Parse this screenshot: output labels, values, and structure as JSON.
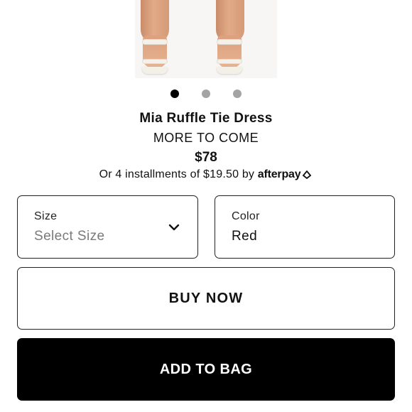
{
  "carousel": {
    "slide_count": 3,
    "active_index": 0
  },
  "product": {
    "name": "Mia Ruffle Tie Dress",
    "brand": "MORE TO COME",
    "price": "$78",
    "installments_text": "Or 4 installments of $19.50 by",
    "afterpay_logo": "afterpay",
    "afterpay_icon": "afterpay-arrows-icon"
  },
  "options": {
    "size": {
      "label": "Size",
      "placeholder": "Select Size",
      "icon": "chevron-down-icon"
    },
    "color": {
      "label": "Color",
      "value": "Red"
    }
  },
  "actions": {
    "buy_now": "BUY NOW",
    "add_to_bag": "ADD TO BAG"
  },
  "colors": {
    "primary_button_bg": "#000000",
    "primary_button_text": "#ffffff",
    "border": "#222222",
    "placeholder_text": "#7a7a7a",
    "dot_inactive": "#a4a4a4",
    "dot_active": "#000000"
  }
}
